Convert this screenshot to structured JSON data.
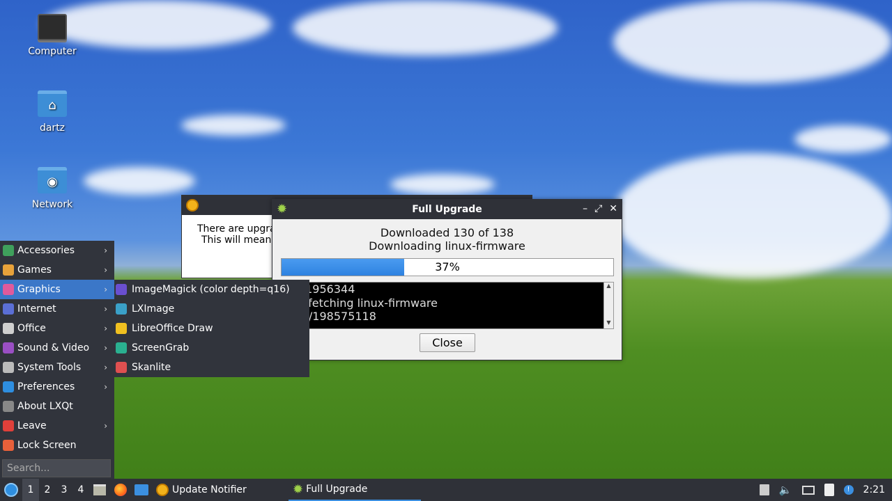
{
  "desktop": {
    "icons": [
      {
        "label": "Computer"
      },
      {
        "label": "dartz"
      },
      {
        "label": "Network"
      }
    ]
  },
  "bg_dialog": {
    "line1": "There are upgra",
    "line2": "This will mean"
  },
  "upgrade_dialog": {
    "title": "Full Upgrade",
    "status_line1": "Downloaded 130 of 138",
    "status_line2": "Downloading linux-firmware",
    "progress": 37,
    "progress_label": "37%",
    "log_lines": [
      "6344/1956344",
      "nload-fetching linux-firmware",
      "23969/198575118"
    ],
    "close_label": "Close"
  },
  "menu": {
    "items": [
      {
        "label": "Accessories",
        "icon": "accessories-icon",
        "color": "#3fa05c",
        "submenu": true
      },
      {
        "label": "Games",
        "icon": "games-icon",
        "color": "#e8a23a",
        "submenu": true
      },
      {
        "label": "Graphics",
        "icon": "graphics-icon",
        "color": "#e05a9c",
        "submenu": true,
        "active": true
      },
      {
        "label": "Internet",
        "icon": "internet-icon",
        "color": "#5b6fd6",
        "submenu": true
      },
      {
        "label": "Office",
        "icon": "office-icon",
        "color": "#cfcfcf",
        "submenu": true
      },
      {
        "label": "Sound & Video",
        "icon": "sound-video-icon",
        "color": "#9a4fc4",
        "submenu": true
      },
      {
        "label": "System Tools",
        "icon": "system-tools-icon",
        "color": "#bbbbbb",
        "submenu": true
      },
      {
        "label": "Preferences",
        "icon": "preferences-icon",
        "color": "#2e8ee0",
        "submenu": true
      },
      {
        "label": "About LXQt",
        "icon": "about-icon",
        "color": "#888888",
        "submenu": false
      },
      {
        "label": "Leave",
        "icon": "leave-icon",
        "color": "#e0403a",
        "submenu": true
      },
      {
        "label": "Lock Screen",
        "icon": "lock-icon",
        "color": "#e8603a",
        "submenu": false
      }
    ],
    "search_placeholder": "Search..."
  },
  "submenu": {
    "items": [
      {
        "label": "ImageMagick (color depth=q16)",
        "icon": "imagemagick-icon",
        "color": "#6a4fd0"
      },
      {
        "label": "LXImage",
        "icon": "lximage-icon",
        "color": "#3aa0c8"
      },
      {
        "label": "LibreOffice Draw",
        "icon": "libreoffice-draw-icon",
        "color": "#f0c020"
      },
      {
        "label": "ScreenGrab",
        "icon": "screengrab-icon",
        "color": "#2ab090"
      },
      {
        "label": "Skanlite",
        "icon": "skanlite-icon",
        "color": "#e05050"
      }
    ]
  },
  "taskbar": {
    "workspaces": [
      "1",
      "2",
      "3",
      "4"
    ],
    "tasks": [
      {
        "label": "Update Notifier"
      },
      {
        "label": "Full Upgrade"
      }
    ],
    "clock": "2:21"
  }
}
